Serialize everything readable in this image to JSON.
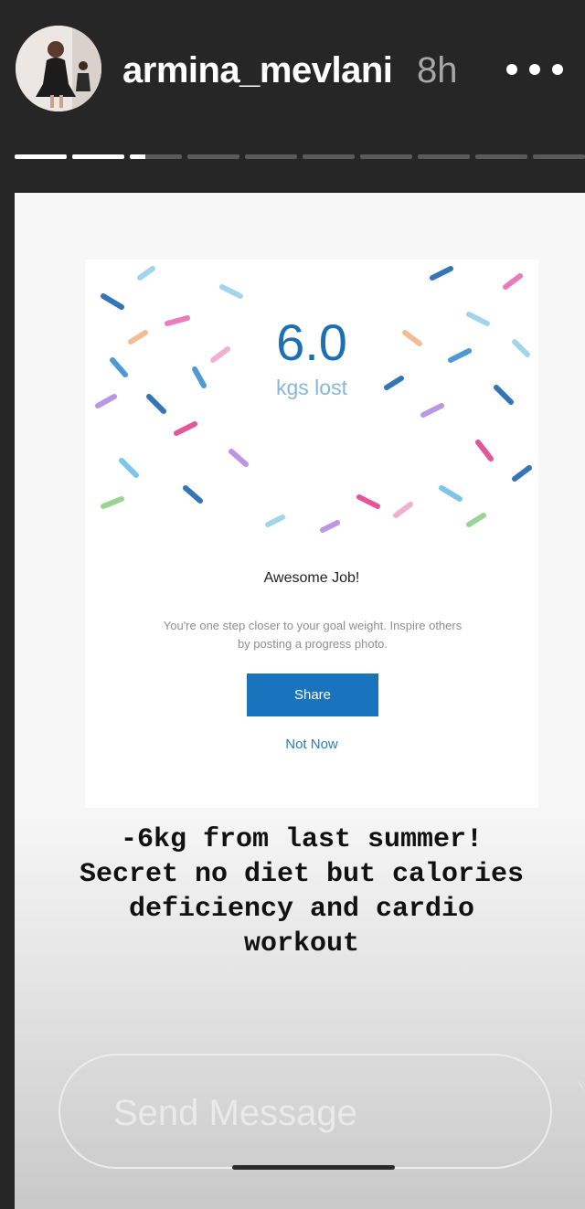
{
  "header": {
    "username": "armina_mevlani",
    "time": "8h",
    "progress": {
      "total": 10,
      "completed": 2.3
    }
  },
  "post": {
    "result_value": "6.0",
    "result_unit": "kgs lost",
    "heading": "Awesome Job!",
    "subtext_lines": [
      "You're one step closer to your goal weight. Inspire others",
      "by posting a progress photo."
    ],
    "share_label": "Share",
    "not_now_label": "Not Now",
    "accent_color": "#1a73bd"
  },
  "caption": {
    "lines": [
      "-6kg from last summer!",
      "Secret no diet but calories",
      "deficiency and cardio",
      "workout"
    ]
  },
  "reply": {
    "placeholder": "Send Message"
  }
}
